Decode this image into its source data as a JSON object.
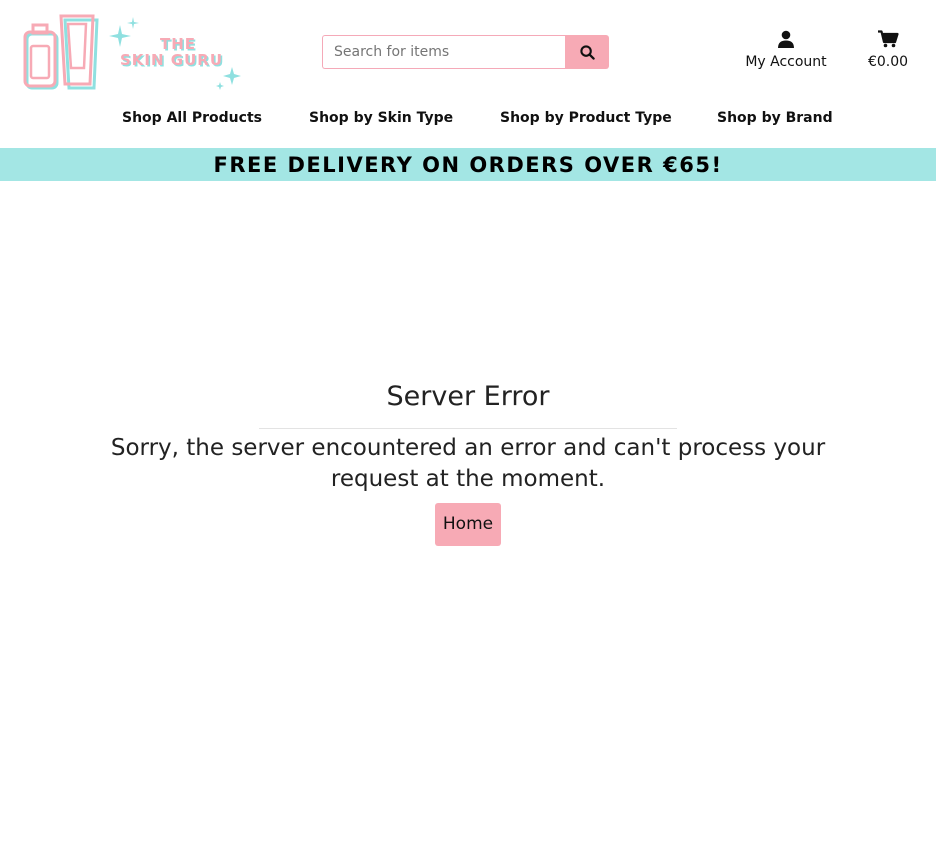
{
  "logo": {
    "line1": "THE",
    "line2": "SKIN GURU"
  },
  "search": {
    "placeholder": "Search for items",
    "value": ""
  },
  "account": {
    "label": "My Account"
  },
  "cart": {
    "total": "€0.00"
  },
  "nav": {
    "items": [
      {
        "label": "Shop All Products"
      },
      {
        "label": "Shop by Skin Type"
      },
      {
        "label": "Shop by Product Type"
      },
      {
        "label": "Shop by Brand"
      }
    ]
  },
  "banner": {
    "text": "FREE DELIVERY ON ORDERS OVER €65!"
  },
  "error": {
    "title": "Server Error",
    "message": "Sorry, the server encountered an error and can't process your request at the moment.",
    "home_label": "Home"
  },
  "colors": {
    "brand_pink": "#f7aab5",
    "banner_teal": "#a3e6e4",
    "logo_shadow": "#8fe0e0"
  }
}
